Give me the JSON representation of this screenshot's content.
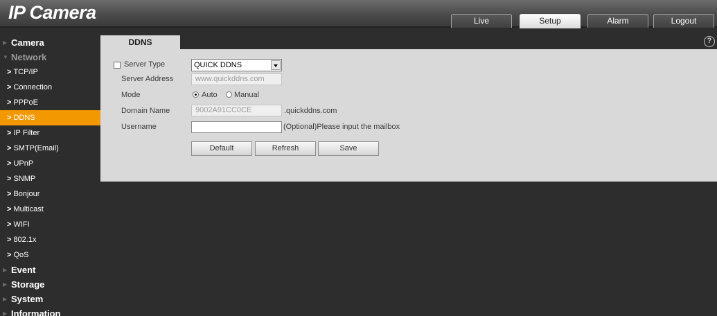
{
  "header": {
    "logo_ip": "IP",
    "logo_camera": "Camera",
    "tabs": [
      {
        "label": "Live",
        "active": false
      },
      {
        "label": "Setup",
        "active": true
      },
      {
        "label": "Alarm",
        "active": false
      },
      {
        "label": "Logout",
        "active": false
      }
    ]
  },
  "sidebar": {
    "camera": "Camera",
    "network": "Network",
    "network_items": [
      {
        "label": "TCP/IP"
      },
      {
        "label": "Connection"
      },
      {
        "label": "PPPoE"
      },
      {
        "label": "DDNS",
        "selected": true
      },
      {
        "label": "IP Filter"
      },
      {
        "label": "SMTP(Email)"
      },
      {
        "label": "UPnP"
      },
      {
        "label": "SNMP"
      },
      {
        "label": "Bonjour"
      },
      {
        "label": "Multicast"
      },
      {
        "label": "WIFI"
      },
      {
        "label": "802.1x"
      },
      {
        "label": "QoS"
      }
    ],
    "event": "Event",
    "storage": "Storage",
    "system": "System",
    "information": "Information",
    "selected_color": "#f39800"
  },
  "content": {
    "tab_label": "DDNS",
    "help_glyph": "?",
    "form": {
      "server_type_label": "Server Type",
      "server_type_checked": false,
      "server_type_value": "QUICK DDNS",
      "server_address_label": "Server Address",
      "server_address_value": "www.quickddns.com",
      "mode_label": "Mode",
      "mode_auto": "Auto",
      "mode_manual": "Manual",
      "mode_selected": "Auto",
      "domain_name_label": "Domain Name",
      "domain_name_value": "9002A91CC0CE",
      "domain_suffix": ".quickddns.com",
      "username_label": "Username",
      "username_value": "",
      "username_hint": "(Optional)Please input the mailbox"
    },
    "buttons": {
      "default": "Default",
      "refresh": "Refresh",
      "save": "Save"
    }
  }
}
